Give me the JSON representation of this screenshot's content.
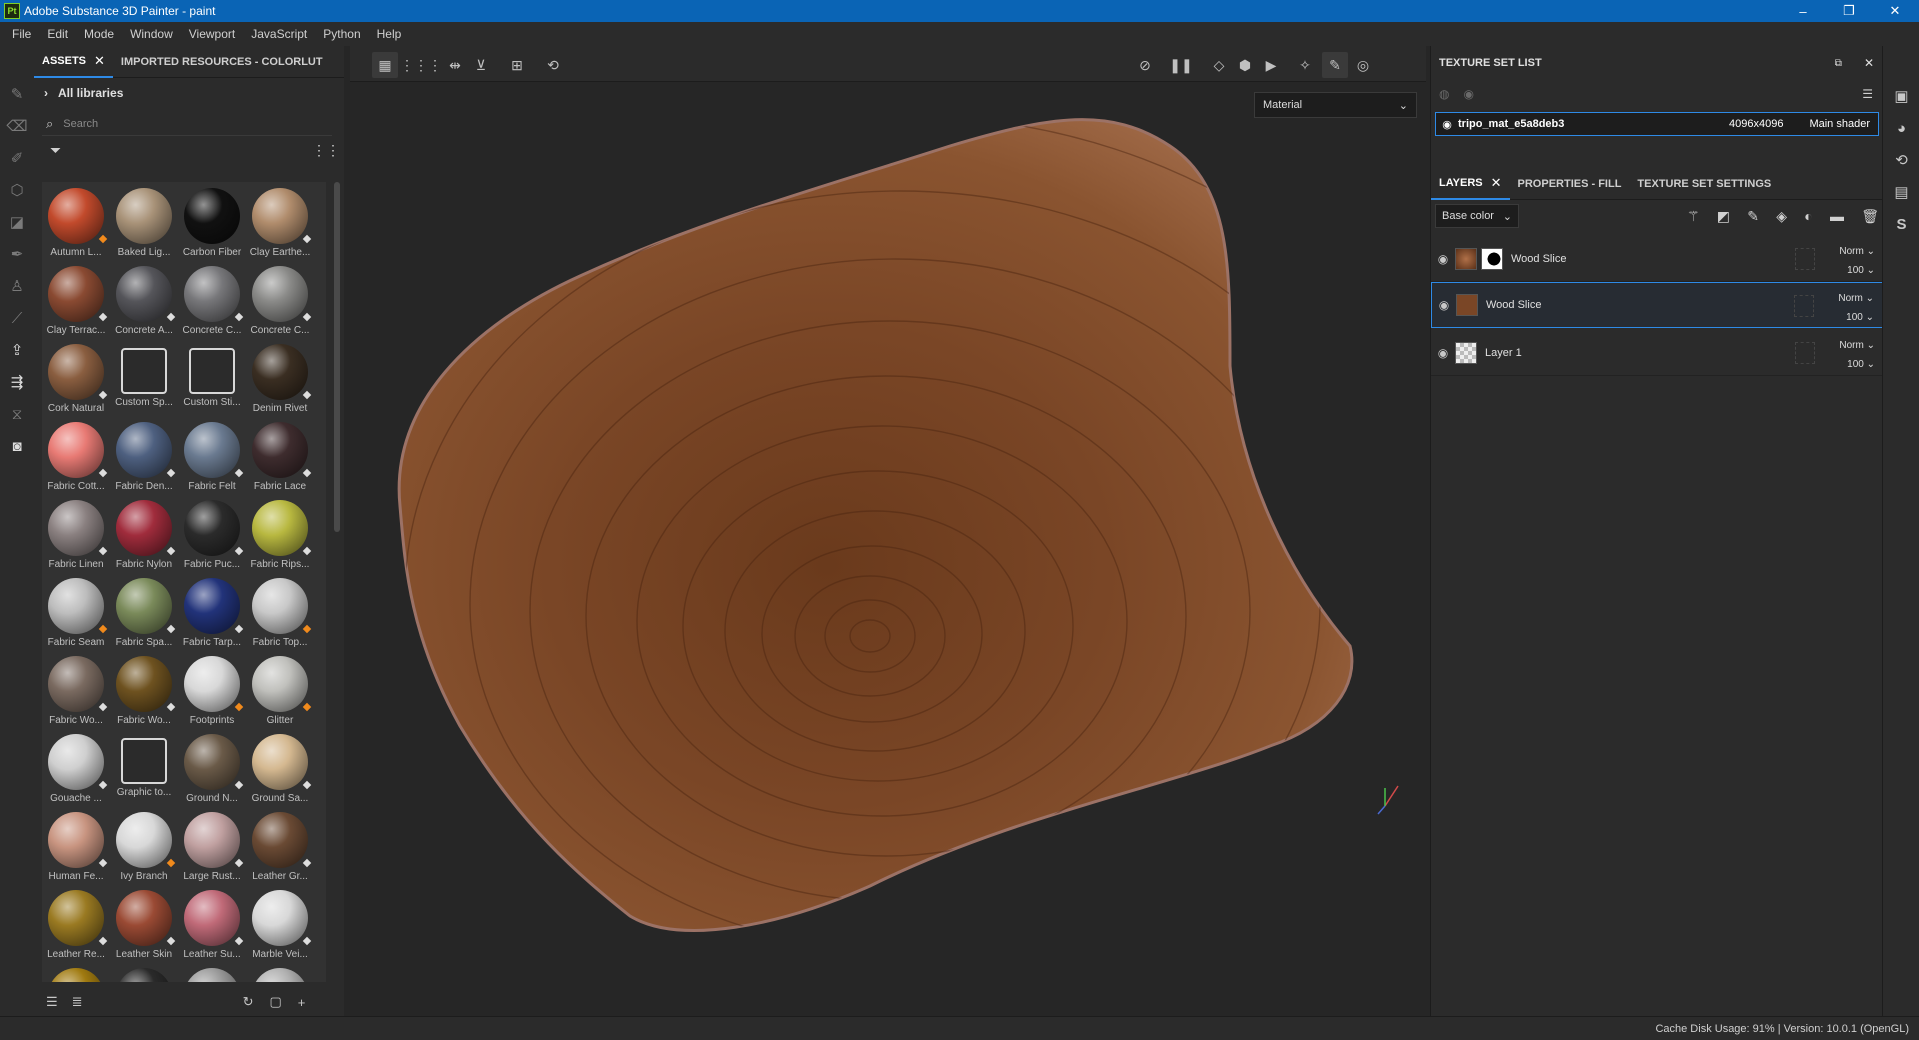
{
  "app": {
    "title": "Adobe Substance 3D Painter - paint",
    "logo": "Pt"
  },
  "window_controls": {
    "minimize": "–",
    "restore": "❐",
    "close": "✕"
  },
  "menu": [
    "File",
    "Edit",
    "Mode",
    "Window",
    "Viewport",
    "JavaScript",
    "Python",
    "Help"
  ],
  "assets_panel": {
    "tabs": [
      "ASSETS",
      "IMPORTED RESOURCES - COLORLUT"
    ],
    "library": "All libraries",
    "search_placeholder": "Search",
    "items": [
      {
        "label": "Autumn L...",
        "color": "#c24a2c",
        "mark": "orange"
      },
      {
        "label": "Baked Lig...",
        "color": "#a89278",
        "mark": ""
      },
      {
        "label": "Carbon Fiber",
        "color": "#111111",
        "mark": ""
      },
      {
        "label": "Clay Earthe...",
        "color": "#b08c6c",
        "mark": "white"
      },
      {
        "label": "Clay Terrac...",
        "color": "#8a4a32",
        "mark": "white"
      },
      {
        "label": "Concrete A...",
        "color": "#55555a",
        "mark": "white"
      },
      {
        "label": "Concrete C...",
        "color": "#77777a",
        "mark": "white"
      },
      {
        "label": "Concrete C...",
        "color": "#8a8a88",
        "mark": "white"
      },
      {
        "label": "Cork Natural",
        "color": "#8a5e40",
        "mark": "white"
      },
      {
        "label": "Custom Sp...",
        "color": "#2b2b2b",
        "mark": "icon-pen"
      },
      {
        "label": "Custom Sti...",
        "color": "#2b2b2b",
        "mark": "icon-sticker"
      },
      {
        "label": "Denim Rivet",
        "color": "#3a2e22",
        "mark": "white"
      },
      {
        "label": "Fabric Cott...",
        "color": "#e87a74",
        "mark": "white"
      },
      {
        "label": "Fabric Den...",
        "color": "#4e6080",
        "mark": "white"
      },
      {
        "label": "Fabric Felt",
        "color": "#6a7a90",
        "mark": "white"
      },
      {
        "label": "Fabric Lace",
        "color": "#3e2c2e",
        "mark": "white"
      },
      {
        "label": "Fabric Linen",
        "color": "#8a8080",
        "mark": "white"
      },
      {
        "label": "Fabric Nylon",
        "color": "#a02c3c",
        "mark": "white"
      },
      {
        "label": "Fabric Puc...",
        "color": "#2b2b2b",
        "mark": "white"
      },
      {
        "label": "Fabric Rips...",
        "color": "#b8b840",
        "mark": "white"
      },
      {
        "label": "Fabric Seam",
        "color": "#bdbdbd",
        "mark": "orange"
      },
      {
        "label": "Fabric Spa...",
        "color": "#7a8a5a",
        "mark": "white"
      },
      {
        "label": "Fabric Tarp...",
        "color": "#22337a",
        "mark": "white"
      },
      {
        "label": "Fabric Top...",
        "color": "#c8c8c8",
        "mark": "orange"
      },
      {
        "label": "Fabric Wo...",
        "color": "#7a6a60",
        "mark": "white"
      },
      {
        "label": "Fabric Wo...",
        "color": "#6e5220",
        "mark": "white"
      },
      {
        "label": "Footprints",
        "color": "#d8d8d8",
        "mark": "orange"
      },
      {
        "label": "Glitter",
        "color": "#c0c0bc",
        "mark": "orange"
      },
      {
        "label": "Gouache ...",
        "color": "#cfcfcf",
        "mark": "white"
      },
      {
        "label": "Graphic to...",
        "color": "#2b2b2b",
        "mark": "icon-graphic"
      },
      {
        "label": "Ground N...",
        "color": "#6a5a48",
        "mark": "white"
      },
      {
        "label": "Ground Sa...",
        "color": "#d4b890",
        "mark": "white"
      },
      {
        "label": "Human Fe...",
        "color": "#c89480",
        "mark": "white"
      },
      {
        "label": "Ivy Branch",
        "color": "#d8d8d8",
        "mark": "orange"
      },
      {
        "label": "Large Rust...",
        "color": "#c0a0a0",
        "mark": "white"
      },
      {
        "label": "Leather Gr...",
        "color": "#6a4a34",
        "mark": "white"
      },
      {
        "label": "Leather Re...",
        "color": "#9a7a22",
        "mark": "white"
      },
      {
        "label": "Leather Skin",
        "color": "#9a4a34",
        "mark": "white"
      },
      {
        "label": "Leather Su...",
        "color": "#c06a78",
        "mark": "white"
      },
      {
        "label": "Marble Vei...",
        "color": "#d8d8d8",
        "mark": "white"
      },
      {
        "label": "",
        "color": "#a07a10",
        "mark": ""
      },
      {
        "label": "",
        "color": "#2a2a2a",
        "mark": ""
      },
      {
        "label": "",
        "color": "#9a9a9a",
        "mark": ""
      },
      {
        "label": "",
        "color": "#b0b0b0",
        "mark": ""
      }
    ]
  },
  "viewport": {
    "material_select": "Material"
  },
  "texture_set_list": {
    "header": "TEXTURE SET LIST",
    "item": {
      "name": "tripo_mat_e5a8deb3",
      "resolution": "4096x4096",
      "shader": "Main shader"
    }
  },
  "layers_panel": {
    "tabs": [
      "LAYERS",
      "PROPERTIES - FILL",
      "TEXTURE SET SETTINGS"
    ],
    "channel": "Base color",
    "layers": [
      {
        "name": "Wood Slice",
        "blend": "Norm",
        "opacity": "100",
        "selected": false,
        "mask": true
      },
      {
        "name": "Wood Slice",
        "blend": "Norm",
        "opacity": "100",
        "selected": true,
        "mask": false
      },
      {
        "name": "Layer 1",
        "blend": "Norm",
        "opacity": "100",
        "selected": false,
        "mask": false
      }
    ]
  },
  "status": {
    "text": "Cache Disk Usage:   91% | Version: 10.0.1 (OpenGL)"
  },
  "colors": {
    "accent": "#2e8ae6",
    "titlebar": "#0a64b5",
    "wood": "#7a4626"
  }
}
